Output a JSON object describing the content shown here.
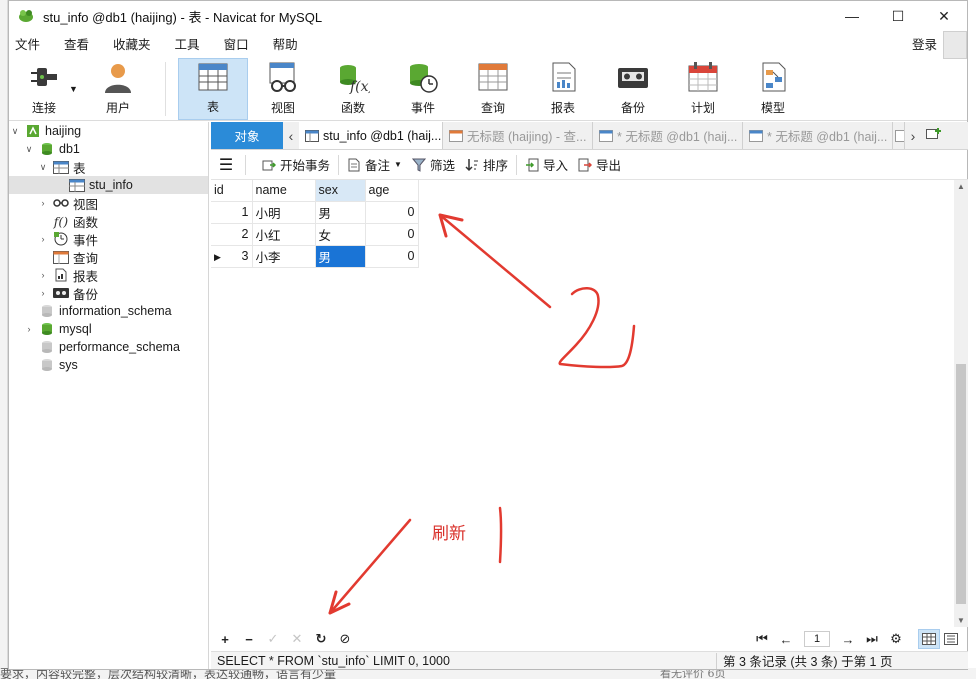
{
  "window": {
    "title": "stu_info @db1 (haijing) - 表 - Navicat for MySQL",
    "controls": {
      "minimize": "—",
      "maximize": "☐",
      "close": "✕"
    }
  },
  "menu": {
    "items": [
      "文件",
      "查看",
      "收藏夹",
      "工具",
      "窗口",
      "帮助"
    ],
    "login": "登录"
  },
  "toolbar": {
    "items": [
      {
        "label": "连接",
        "icon": "connection-plug-icon"
      },
      {
        "label": "用户",
        "icon": "user-icon"
      },
      {
        "label": "表",
        "icon": "table-icon",
        "active": true
      },
      {
        "label": "视图",
        "icon": "view-glasses-icon"
      },
      {
        "label": "函数",
        "icon": "function-icon"
      },
      {
        "label": "事件",
        "icon": "event-clock-icon"
      },
      {
        "label": "查询",
        "icon": "query-icon"
      },
      {
        "label": "报表",
        "icon": "report-icon"
      },
      {
        "label": "备份",
        "icon": "backup-tape-icon"
      },
      {
        "label": "计划",
        "icon": "schedule-calendar-icon"
      },
      {
        "label": "模型",
        "icon": "model-icon"
      }
    ]
  },
  "tree": {
    "connection": "haijing",
    "database": "db1",
    "tables_node": "表",
    "selected_table": "stu_info",
    "db1_children": [
      "视图",
      "函数",
      "事件",
      "查询",
      "报表",
      "备份"
    ],
    "other_databases": [
      "information_schema",
      "mysql",
      "performance_schema",
      "sys"
    ]
  },
  "tabs": {
    "objects": "对象",
    "items": [
      {
        "label": "stu_info @db1 (haij...",
        "active": true
      },
      {
        "label": "无标题 (haijing) - 查...",
        "active": false
      },
      {
        "label": "* 无标题 @db1 (haij...",
        "active": false
      },
      {
        "label": "* 无标题 @db1 (haij...",
        "active": false
      }
    ]
  },
  "gridbar": {
    "begin_transaction": "开始事务",
    "memo": "备注",
    "filter": "筛选",
    "sort": "排序",
    "import": "导入",
    "export": "导出"
  },
  "grid": {
    "columns": [
      "id",
      "name",
      "sex",
      "age"
    ],
    "selected_column": "sex",
    "rows": [
      {
        "id": "1",
        "name": "小明",
        "sex": "男",
        "age": "0"
      },
      {
        "id": "2",
        "name": "小红",
        "sex": "女",
        "age": "0"
      },
      {
        "id": "3",
        "name": "小李",
        "sex": "男",
        "age": "0"
      }
    ],
    "current_row_marker": "▶"
  },
  "bottombar": {
    "add": "+",
    "delete": "−",
    "apply": "✓",
    "discard": "✕",
    "refresh": "↻",
    "stop": "⊘",
    "page": "1"
  },
  "status": {
    "sql": "SELECT * FROM `stu_info` LIMIT 0, 1000",
    "record_info": "第 3 条记录 (共 3 条) 于第 1 页"
  },
  "annotation": {
    "label": "刷新",
    "color": "#d9302a"
  },
  "background_text": {
    "bottom": "要求，内容较完整，层次结构较清晰，表达较通畅，语言有少量",
    "bottom_right": "看无评价        6页"
  }
}
